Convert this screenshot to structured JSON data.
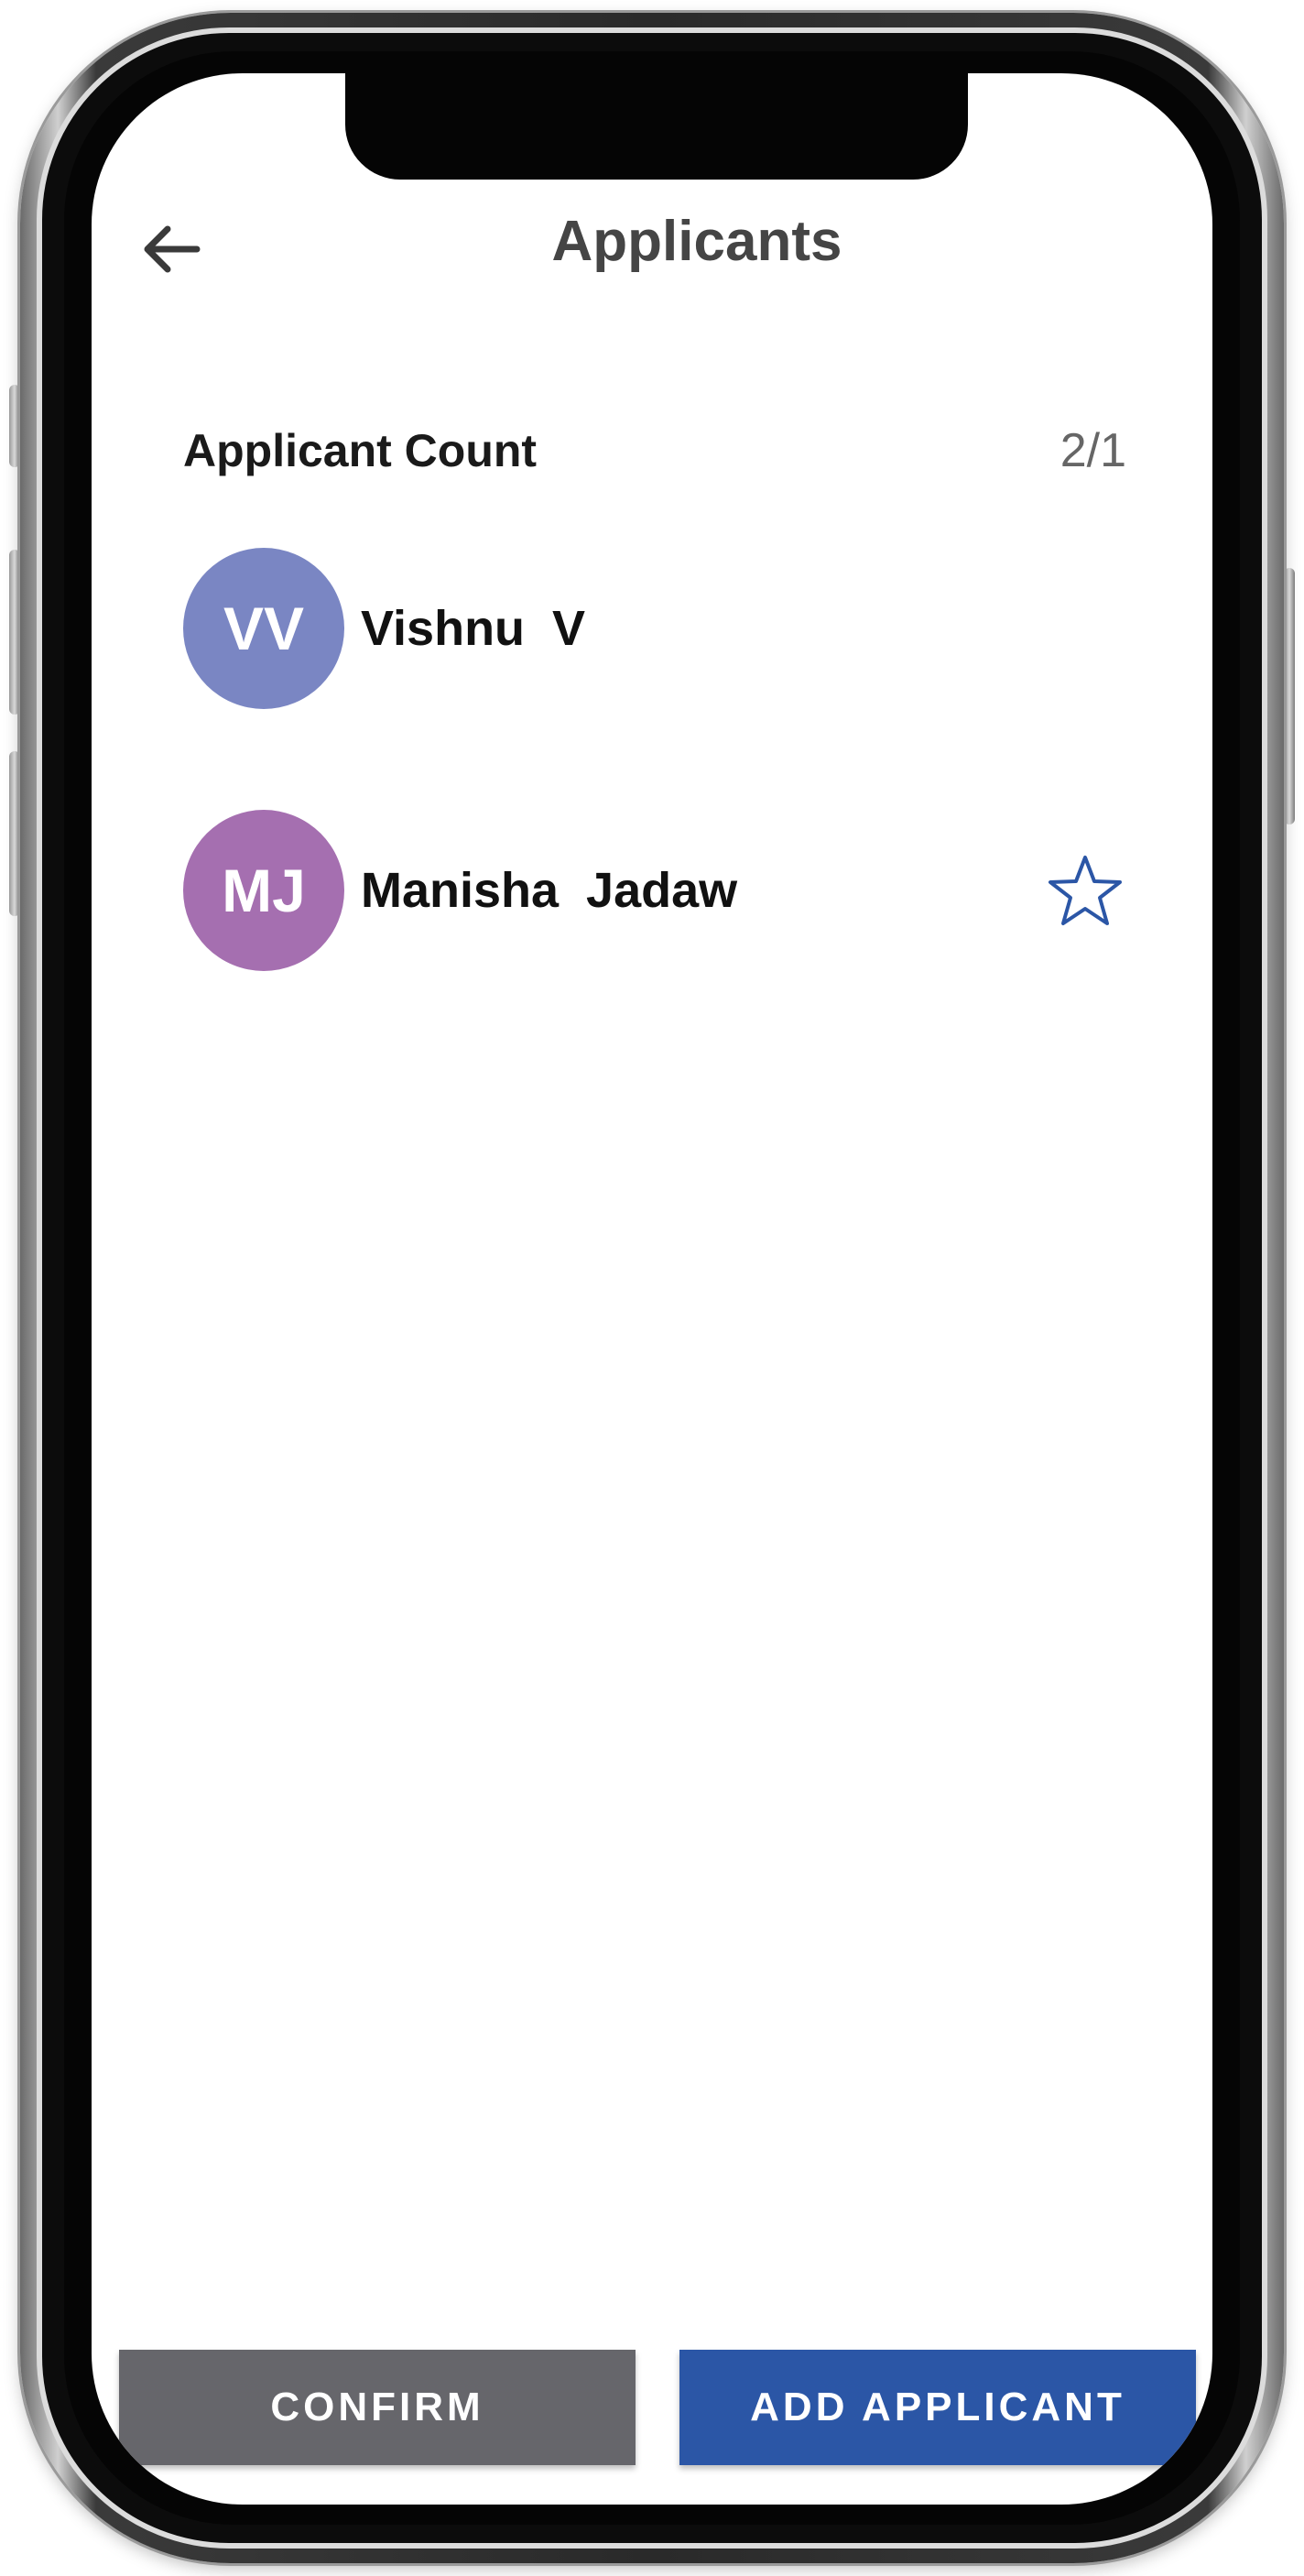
{
  "header": {
    "title": "Applicants",
    "back_icon": "arrow-left-icon"
  },
  "summary": {
    "count_label": "Applicant Count",
    "count_value": "2/1"
  },
  "applicants": [
    {
      "initials": "VV",
      "name": "Vishnu  V",
      "avatar_color": "#7a86c3",
      "starred": false
    },
    {
      "initials": "MJ",
      "name": "Manisha  Jadaw",
      "avatar_color": "#a56fb0",
      "starred": true,
      "star_icon": "star-outline-icon"
    }
  ],
  "actions": {
    "confirm_label": "CONFIRM",
    "add_label": "ADD APPLICANT"
  },
  "colors": {
    "primary": "#2b56a6",
    "secondary": "#66666b"
  }
}
